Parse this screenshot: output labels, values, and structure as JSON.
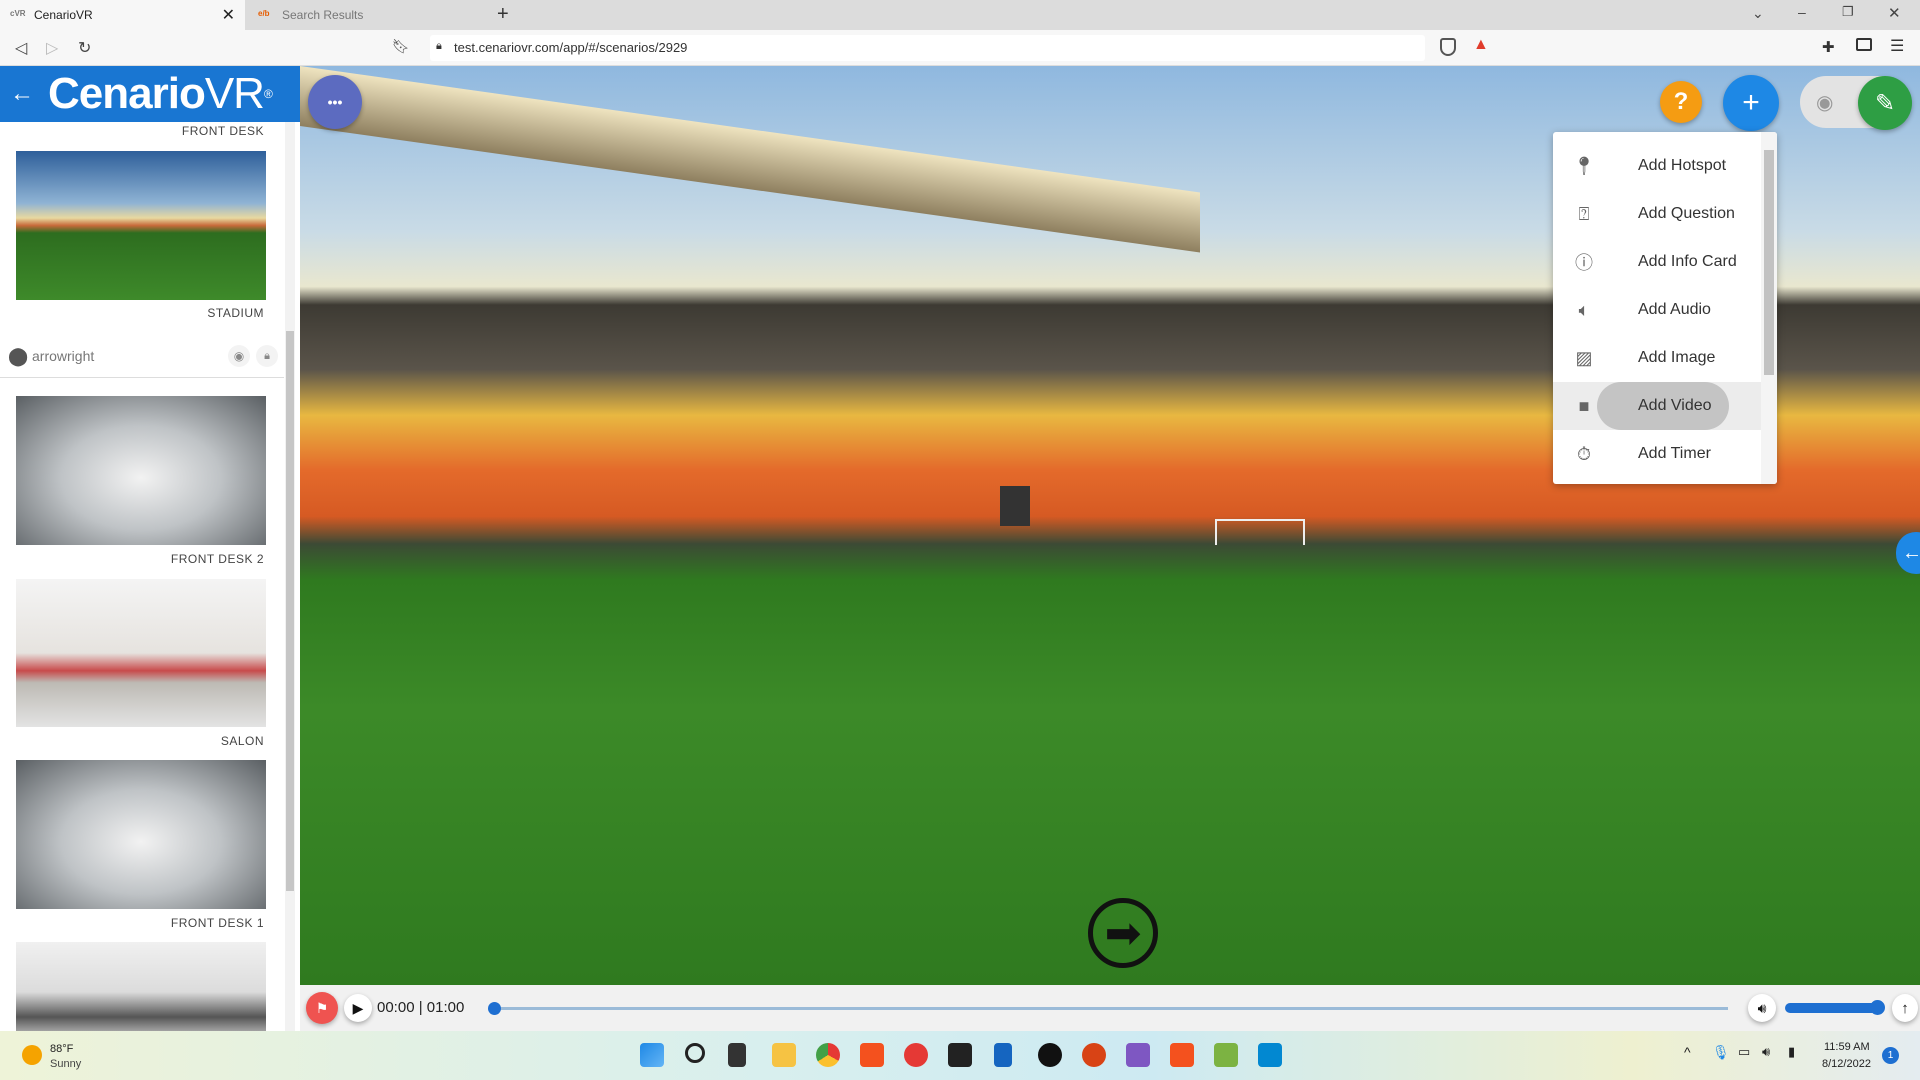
{
  "browser": {
    "tabs": [
      {
        "favicon": "cVR",
        "title": "CenarioVR",
        "active": true
      },
      {
        "favicon": "e/b",
        "title": "Search Results",
        "active": false
      }
    ],
    "new_tab": "+",
    "url": "test.cenariovr.com/app/#/scenarios/2929"
  },
  "sidebar": {
    "brand": "Cenario",
    "brand_suffix": "VR",
    "registered": "®",
    "back_icon": "arrow-left-icon",
    "top_label": "FRONT DESK",
    "scenes": [
      {
        "label": "STADIUM"
      },
      {
        "label": "FRONT DESK 2"
      },
      {
        "label": "SALON"
      },
      {
        "label": "FRONT DESK 1"
      }
    ],
    "hotspot": {
      "name": "arrowright"
    }
  },
  "toolbar": {
    "more": "•••",
    "help": "?",
    "add": "+",
    "edit_icon": "pencil-icon",
    "preview_icon": "eye-icon",
    "colors": {
      "help": "#f59c12",
      "add": "#1e88e5",
      "edit": "#2e9e44",
      "more": "#5c6bc0"
    }
  },
  "add_menu": {
    "items": [
      {
        "label": "Add Hotspot",
        "icon": "map-pin-icon"
      },
      {
        "label": "Add Question",
        "icon": "question-bubble-icon"
      },
      {
        "label": "Add Info Card",
        "icon": "info-icon"
      },
      {
        "label": "Add Audio",
        "icon": "speaker-icon"
      },
      {
        "label": "Add Image",
        "icon": "image-icon"
      },
      {
        "label": "Add Video",
        "icon": "video-camera-icon",
        "hovered": true
      },
      {
        "label": "Add Timer",
        "icon": "stopwatch-icon"
      }
    ]
  },
  "player": {
    "time": "00:00 | 01:00",
    "progress": 0,
    "volume": 1.0
  },
  "taskbar": {
    "weather_temp": "88°F",
    "weather_desc": "Sunny",
    "time": "11:59 AM",
    "date": "8/12/2022",
    "notifications": "1"
  }
}
